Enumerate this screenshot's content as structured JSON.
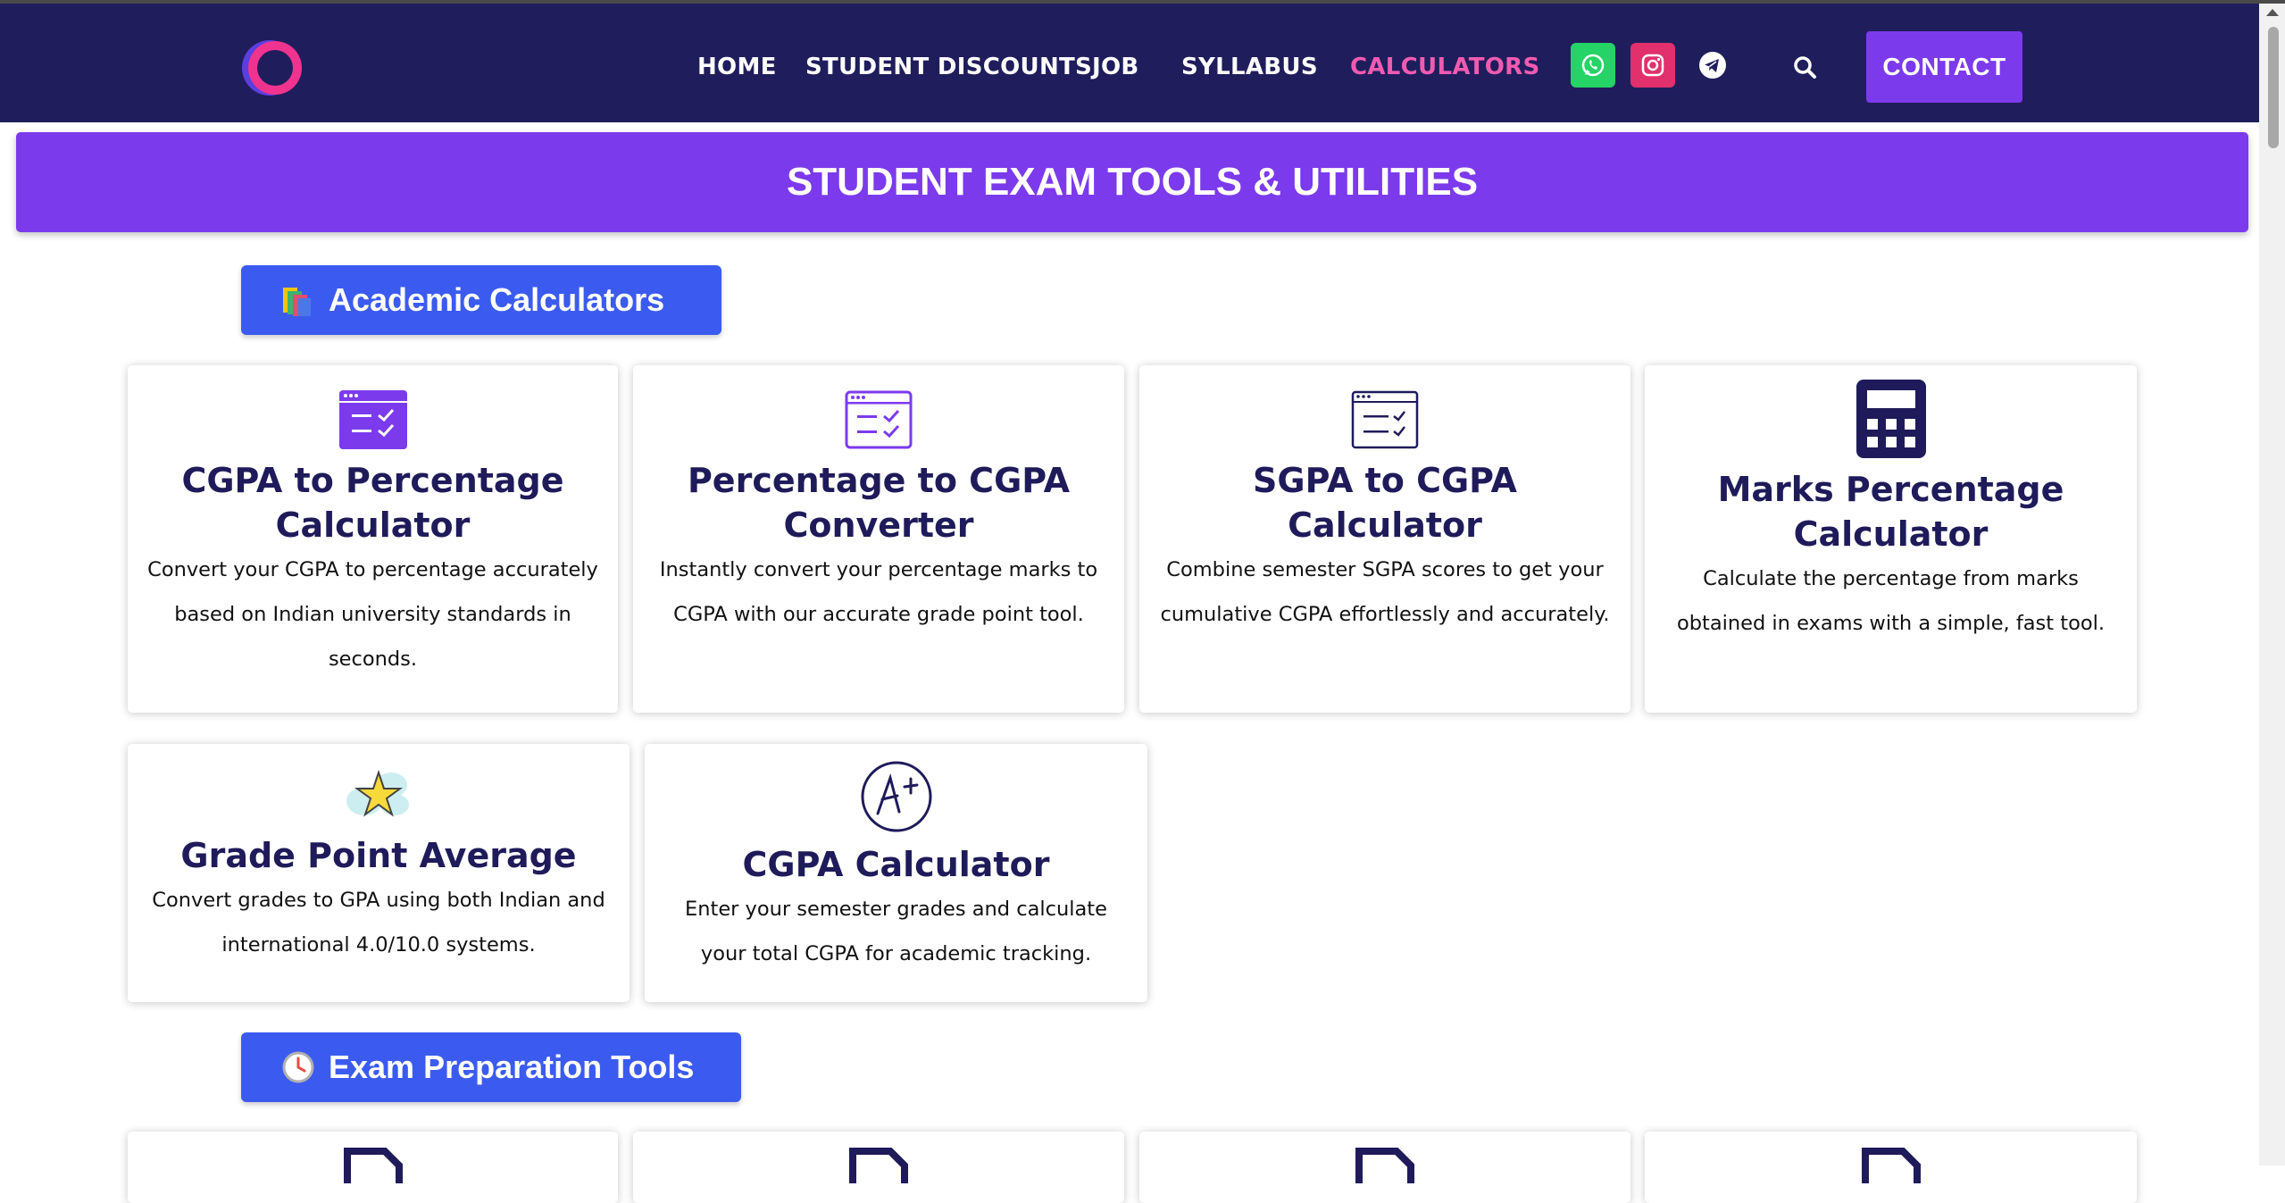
{
  "nav": {
    "links": [
      "HOME",
      "STUDENT DISCOUNTS",
      "JOB",
      "SYLLABUS",
      "CALCULATORS"
    ],
    "contact_label": "CONTACT",
    "colors": {
      "bar": "#201d5c",
      "active": "#f05bb0",
      "whatsapp": "#25d366",
      "instagram": "#e1306c",
      "telegram": "#ffffff",
      "contact": "#7c3aed"
    },
    "social_icons": [
      "whatsapp-icon",
      "instagram-icon",
      "telegram-icon"
    ]
  },
  "banner": {
    "title": "STUDENT EXAM TOOLS & UTILITIES"
  },
  "sections": [
    {
      "label": "Academic Calculators",
      "icon": "books-icon"
    },
    {
      "label": "Exam Preparation Tools",
      "icon": "clock-icon"
    }
  ],
  "cards": [
    {
      "title": "CGPA to Percentage Calculator",
      "desc": "Convert your CGPA to percentage accurately based on Indian university standards in seconds.",
      "icon": "checklist-window-icon"
    },
    {
      "title": "Percentage to CGPA Converter",
      "desc": "Instantly convert your percentage marks to CGPA with our accurate grade point tool.",
      "icon": "checklist-window-outline-icon"
    },
    {
      "title": "SGPA to CGPA Calculator",
      "desc": "Combine semester SGPA scores to get your cumulative CGPA effortlessly and accurately.",
      "icon": "checklist-window-dark-icon"
    },
    {
      "title": "Marks Percentage Calculator",
      "desc": "Calculate the percentage from marks obtained in exams with a simple, fast tool.",
      "icon": "calculator-icon"
    },
    {
      "title": "Grade Point Average",
      "desc": "Convert grades to GPA using both Indian and international 4.0/10.0 systems.",
      "icon": "star-cloud-icon"
    },
    {
      "title": "CGPA Calculator",
      "desc": "Enter your semester grades and calculate your total CGPA for academic tracking.",
      "icon": "a-plus-icon"
    }
  ]
}
